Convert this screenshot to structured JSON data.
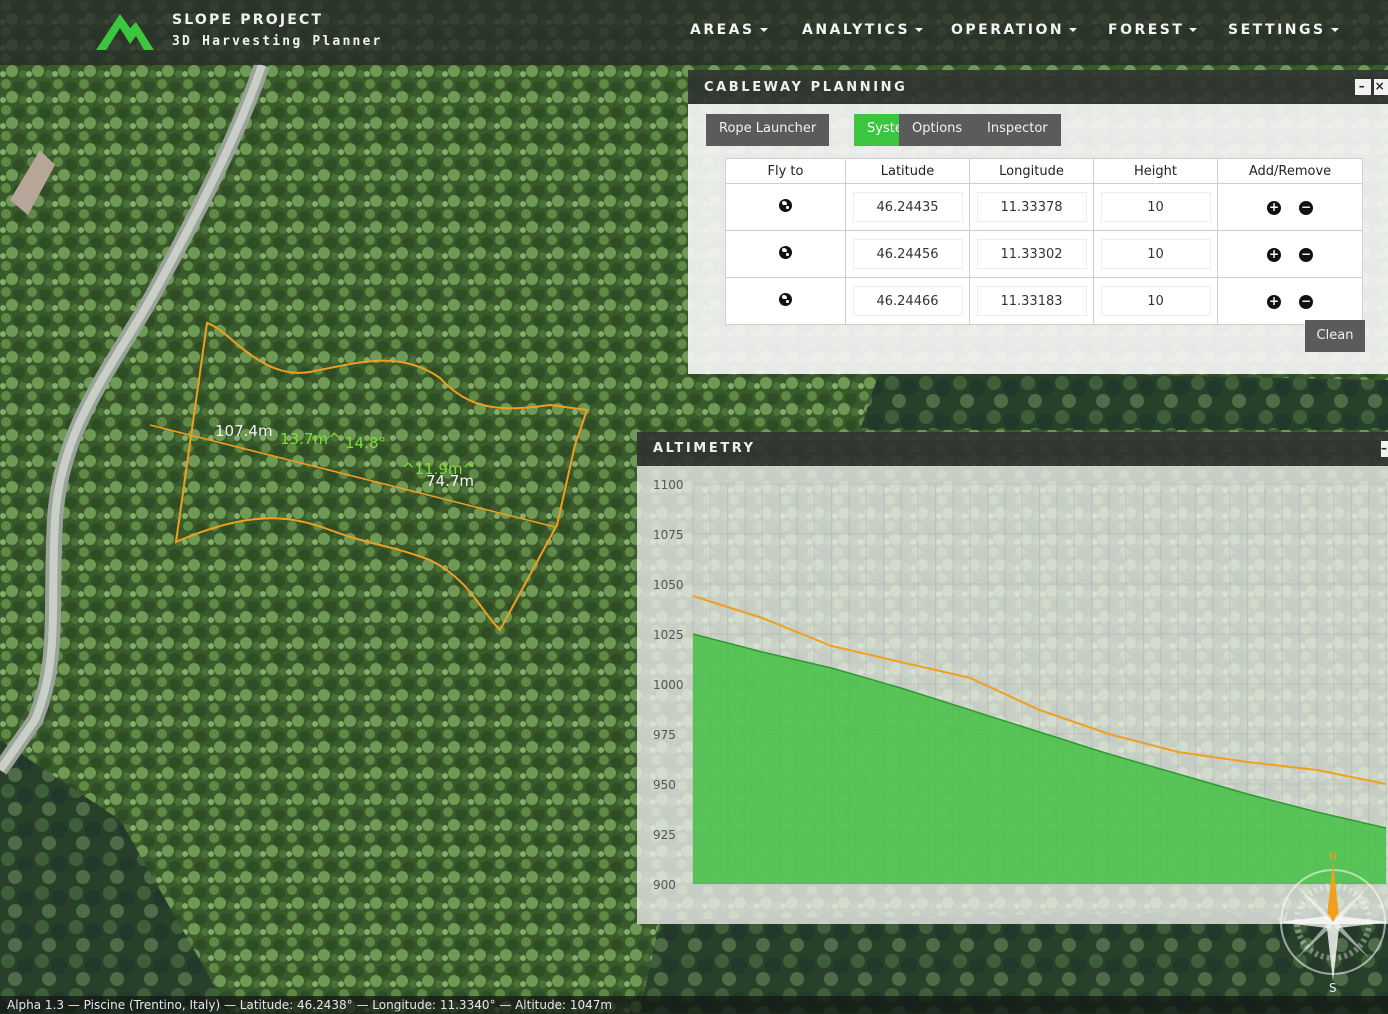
{
  "brand": {
    "title": "SLOPE PROJECT",
    "subtitle": "3D Harvesting Planner"
  },
  "nav": [
    "AREAS",
    "ANALYTICS",
    "OPERATION",
    "FOREST",
    "SETTINGS"
  ],
  "cableway_panel": {
    "title": "CABLEWAY PLANNING",
    "minimize": "–",
    "close": "×",
    "tabs": [
      {
        "label": "Rope Launcher",
        "active": false
      },
      {
        "label": "System",
        "active": true
      },
      {
        "label": "Options",
        "active": false
      },
      {
        "label": "Inspector",
        "active": false
      }
    ],
    "columns": [
      "Fly to",
      "Latitude",
      "Longitude",
      "Height",
      "Add/Remove"
    ],
    "rows": [
      {
        "latitude": "46.24435",
        "longitude": "11.33378",
        "height": "10"
      },
      {
        "latitude": "46.24456",
        "longitude": "11.33302",
        "height": "10"
      },
      {
        "latitude": "46.24466",
        "longitude": "11.33183",
        "height": "10"
      }
    ],
    "clean_label": "Clean"
  },
  "map_labels": {
    "length_1": "107.4m",
    "height_1": "13.7m^",
    "angle_1": "14.8°",
    "height_2": "^11.9m^",
    "length_2": "74.7m"
  },
  "altimetry_panel": {
    "title": "ALTIMETRY",
    "minimize": "–"
  },
  "chart_data": {
    "type": "area",
    "title": "ALTIMETRY",
    "xlabel": "",
    "ylabel": "",
    "ylim": [
      900,
      1100
    ],
    "yticks": [
      1100,
      1075,
      1050,
      1025,
      1000,
      975,
      950,
      925,
      900
    ],
    "x": [
      0,
      10,
      20,
      30,
      40,
      50,
      60,
      70,
      80,
      90,
      100
    ],
    "series": [
      {
        "kind": "terrain-area",
        "color": "#43c043",
        "values": [
          1025,
          1016,
          1008,
          998,
          987,
          976,
          965,
          955,
          945,
          936,
          928
        ]
      },
      {
        "kind": "cable-line",
        "color": "#f0a020",
        "values": [
          1044,
          1033,
          1019,
          1011,
          1003,
          987,
          975,
          966,
          961,
          957,
          950
        ]
      }
    ]
  },
  "compass": {
    "north": "N",
    "south": "S",
    "west": "W"
  },
  "status_bar": "Alpha 1.3 — Piscine (Trentino, Italy) — Latitude: 46.2438° — Longitude: 11.3340° — Altitude: 1047m",
  "colors": {
    "accent": "#3cc53e",
    "route": "#f0a020",
    "terrain": "#43c043",
    "panel_header": "#303432"
  }
}
